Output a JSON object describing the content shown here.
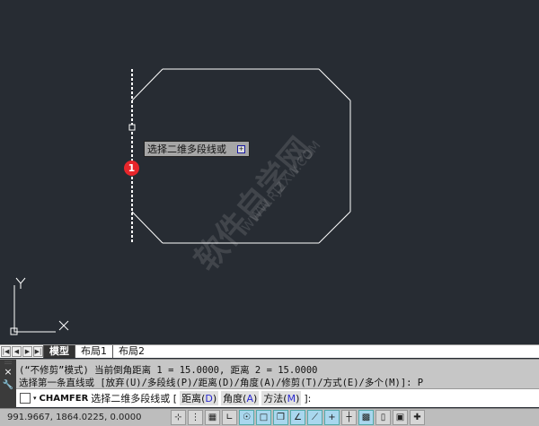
{
  "tooltip": {
    "text": "选择二维多段线或",
    "button": "+"
  },
  "badge": "1",
  "watermark": {
    "text": "软件自学网",
    "url": "WWW.RJZXW.COM"
  },
  "ucs": {
    "x_label": "X",
    "y_label": "Y"
  },
  "tabs": {
    "nav": [
      "|◀",
      "◀",
      "▶",
      "▶|"
    ],
    "items": [
      "模型",
      "布局1",
      "布局2"
    ]
  },
  "command": {
    "history": [
      "(“不修剪”模式) 当前倒角距离 1 = 15.0000, 距离 2 = 15.0000",
      "选择第一条直线或 [放弃(U)/多段线(P)/距离(D)/角度(A)/修剪(T)/方式(E)/多个(M)]: P"
    ],
    "close": "×",
    "wrench": "🔧",
    "name": "CHAMFER",
    "prompt": "选择二维多段线或 [",
    "options": [
      {
        "label": "距离(",
        "key": "D",
        "end": ")"
      },
      {
        "label": "角度(",
        "key": "A",
        "end": ")"
      },
      {
        "label": "方法(",
        "key": "M",
        "end": ")"
      }
    ],
    "suffix": "]:"
  },
  "status": {
    "coords": "991.9667,   1864.0225, 0.0000",
    "buttons": [
      {
        "name": "infer",
        "g": "⊹",
        "on": false
      },
      {
        "name": "snap",
        "g": "⋮",
        "on": false
      },
      {
        "name": "grid",
        "g": "▦",
        "on": false
      },
      {
        "name": "ortho",
        "g": "∟",
        "on": false
      },
      {
        "name": "polar",
        "g": "☉",
        "on": true
      },
      {
        "name": "osnap",
        "g": "□",
        "on": true
      },
      {
        "name": "3dosnap",
        "g": "❒",
        "on": true
      },
      {
        "name": "otrack",
        "g": "∠",
        "on": true
      },
      {
        "name": "ducs",
        "g": "⟋",
        "on": true
      },
      {
        "name": "dyn",
        "g": "+",
        "on": true
      },
      {
        "name": "lwt",
        "g": "┼",
        "on": false
      },
      {
        "name": "tpy",
        "g": "▩",
        "on": true
      },
      {
        "name": "qp",
        "g": "▯",
        "on": false
      },
      {
        "name": "sc",
        "g": "▣",
        "on": false
      },
      {
        "name": "am",
        "g": "✚",
        "on": false
      }
    ]
  }
}
